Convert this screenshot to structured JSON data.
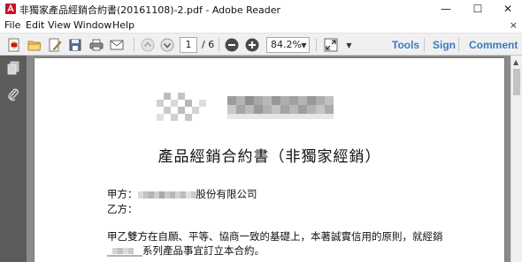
{
  "window": {
    "title": "非獨家產品經銷合約書(20161108)-2.pdf - Adobe Reader",
    "minimize_glyph": "—",
    "maximize_glyph": "☐",
    "close_glyph": "✕"
  },
  "menu": {
    "items": [
      "File",
      "Edit",
      "View",
      "Window",
      "Help"
    ],
    "close_glyph": "×"
  },
  "toolbar": {
    "current_page": "1",
    "total_pages": "/ 6",
    "zoom": "84.2%",
    "tools_label": "Tools",
    "sign_label": "Sign",
    "comment_label": "Comment"
  },
  "document": {
    "title": "產品經銷合約書（非獨家經銷）",
    "party_a_label": "甲方：",
    "party_a_suffix": "股份有限公司",
    "party_b_label": "乙方：",
    "body_line_1": "甲乙雙方在自願、平等、協商一致的基礎上，本著誠實信用的原則，就經銷",
    "body_line_2": "系列產品事宜訂立本合約。"
  },
  "colors": {
    "accent_link": "#3a7bbf",
    "nav_pane": "#5c5c5c",
    "doc_background": "#8a8a8a"
  }
}
